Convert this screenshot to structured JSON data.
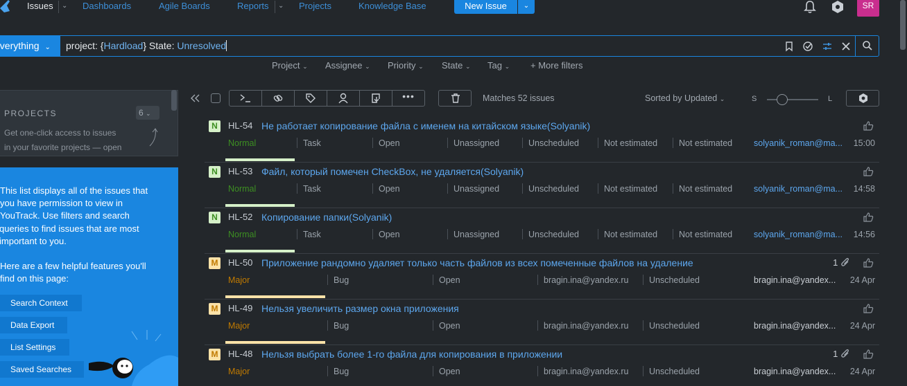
{
  "nav": {
    "issues": "Issues",
    "dashboards": "Dashboards",
    "agile_boards": "Agile Boards",
    "reports": "Reports",
    "projects": "Projects",
    "knowledge_base": "Knowledge Base",
    "new_issue": "New Issue",
    "avatar_initials": "SR"
  },
  "search": {
    "context": "everything",
    "query_prefix": "project: {",
    "query_project": "Hardload",
    "query_mid": "} State: ",
    "query_state": "Unresolved"
  },
  "filters": [
    "Project",
    "Assignee",
    "Priority",
    "State",
    "Tag",
    "More filters"
  ],
  "sidebar": {
    "projects_title": "PROJECTS",
    "projects_count": "6",
    "projects_hint_line1": "Get one-click access to issues",
    "projects_hint_line2": "in your favorite projects — open",
    "help_p1_lines": [
      "This list displays all of the issues that",
      "you have permission to view in",
      "YouTrack. Use filters and search",
      "queries to find issues that are most",
      "important to you."
    ],
    "help_p2_lines": [
      "Here are a few helpful features you'll",
      "find on this page:"
    ],
    "buttons": [
      "Search Context",
      "Data Export",
      "List Settings",
      "Saved Searches"
    ]
  },
  "toolbar": {
    "matches": "Matches 52 issues",
    "sort": "Sorted by Updated",
    "size_small": "S",
    "size_large": "L",
    "size_level": 0.3
  },
  "issues": [
    {
      "id": "HL-54",
      "prio_letter": "N",
      "prio_class": "normal",
      "summary": "Не работает копирование файла с именем на китайском языке(Solyanik)",
      "priority": "Normal",
      "type": "Task",
      "state": "Open",
      "assignee": "Unassigned",
      "f4": "Unscheduled",
      "f5": "Not estimated",
      "f6": "Not estimated",
      "reporter": "solyanik_roman@ma...",
      "time": "15:00",
      "attachments": ""
    },
    {
      "id": "HL-53",
      "prio_letter": "N",
      "prio_class": "normal",
      "summary": "Файл, который помечен CheckBox, не удаляется(Solyanik)",
      "priority": "Normal",
      "type": "Task",
      "state": "Open",
      "assignee": "Unassigned",
      "f4": "Unscheduled",
      "f5": "Not estimated",
      "f6": "Not estimated",
      "reporter": "solyanik_roman@ma...",
      "time": "14:58",
      "attachments": ""
    },
    {
      "id": "HL-52",
      "prio_letter": "N",
      "prio_class": "normal",
      "summary": "Копирование папки(Solyanik)",
      "priority": "Normal",
      "type": "Task",
      "state": "Open",
      "assignee": "Unassigned",
      "f4": "Unscheduled",
      "f5": "Not estimated",
      "f6": "Not estimated",
      "reporter": "solyanik_roman@ma...",
      "time": "14:56",
      "attachments": ""
    },
    {
      "id": "HL-50",
      "prio_letter": "M",
      "prio_class": "major",
      "summary": "Приложение рандомно удаляет только часть файлов из всех помеченные файлов на удаление",
      "priority": "Major",
      "type": "Bug",
      "state": "Open",
      "assignee": "bragin.ina@yandex.ru",
      "f4": "Unscheduled",
      "f5": "",
      "f6": "",
      "reporter": "bragin.ina@yandex...",
      "time": "24 Apr",
      "attachments": "1"
    },
    {
      "id": "HL-49",
      "prio_letter": "M",
      "prio_class": "major",
      "summary": "Нельзя увеличить размер окна приложения",
      "priority": "Major",
      "type": "Bug",
      "state": "Open",
      "assignee": "bragin.ina@yandex.ru",
      "f4": "Unscheduled",
      "f5": "",
      "f6": "",
      "reporter": "bragin.ina@yandex...",
      "time": "24 Apr",
      "attachments": ""
    },
    {
      "id": "HL-48",
      "prio_letter": "M",
      "prio_class": "major",
      "summary": "Нельзя выбрать более 1-го файла для копирования в приложении",
      "priority": "Major",
      "type": "Bug",
      "state": "Open",
      "assignee": "bragin.ina@yandex.ru",
      "f4": "Unscheduled",
      "f5": "",
      "f6": "",
      "reporter": "bragin.ina@yandex...",
      "time": "24 Apr",
      "attachments": "1"
    }
  ],
  "colors": {
    "accent": "#1a86e0",
    "normal": "#3d8f22",
    "major": "#c07a00",
    "link": "#5da7ee"
  }
}
